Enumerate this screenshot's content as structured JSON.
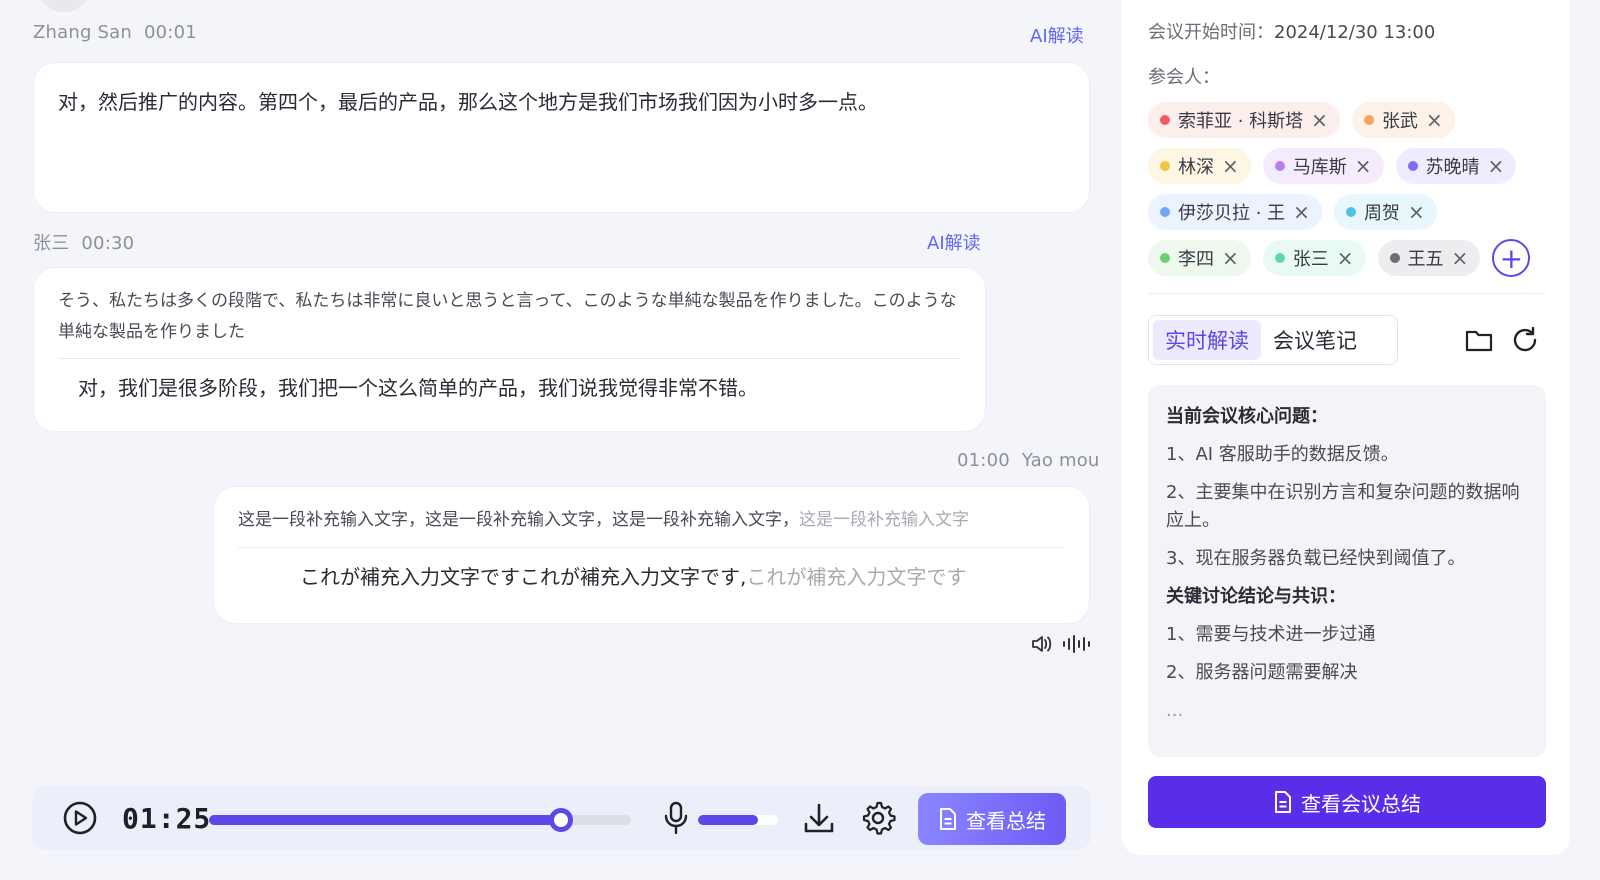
{
  "messages": [
    {
      "speaker": "Zhang San",
      "time": "00:01",
      "ai_label": "AI解读",
      "text": "对，然后推广的内容。第四个，最后的产品，那么这个地方是我们市场我们因为小时多一点。"
    },
    {
      "speaker": "张三",
      "time": "00:30",
      "ai_label": "AI解读",
      "original": "そう、私たちは多くの段階で、私たちは非常に良いと思うと言って、このような単純な製品を作りました。このような単純な製品を作りました",
      "translation": "对，我们是很多阶段，我们把一个这么简单的产品，我们说我觉得非常不错。"
    },
    {
      "speaker": "Yao mou",
      "time": "01:00",
      "original": "这是一段补充输入文字，这是一段补充输入文字，这是一段补充输入文字，",
      "original_pending": "这是一段补充输入文字",
      "translation": "これが補充入力文字ですこれが補充入力文字です,",
      "translation_pending": "これが補充入力文字です"
    }
  ],
  "player": {
    "time": "01:25",
    "progress": 0.835,
    "volume": 0.75,
    "summary_label": "查看总结"
  },
  "panel": {
    "start_time_label": "会议开始时间：",
    "start_time": "2024/12/30 13:00",
    "participants_label": "参会人：",
    "participants": [
      {
        "name": "索菲亚 · 科斯塔",
        "color": "#f25c5c",
        "bg": "#fdeeee"
      },
      {
        "name": "张武",
        "color": "#f6a35c",
        "bg": "#fdf1e8"
      },
      {
        "name": "林深",
        "color": "#f5c542",
        "bg": "#fdf6e3"
      },
      {
        "name": "马库斯",
        "color": "#b87ef0",
        "bg": "#f4ecfd"
      },
      {
        "name": "苏晚晴",
        "color": "#7c6cf0",
        "bg": "#efedfd"
      },
      {
        "name": "伊莎贝拉 · 王",
        "color": "#6ea8f5",
        "bg": "#ebf3fe"
      },
      {
        "name": "周贺",
        "color": "#4fc3e6",
        "bg": "#e8f7fc"
      },
      {
        "name": "李四",
        "color": "#6cd06c",
        "bg": "#edf9ed"
      },
      {
        "name": "张三",
        "color": "#5fd3b5",
        "bg": "#e9f9f4"
      },
      {
        "name": "王五",
        "color": "#6b6d78",
        "bg": "#ededf0"
      }
    ],
    "tabs": [
      "实时解读",
      "会议笔记"
    ],
    "notes": {
      "heading1": "当前会议核心问题：",
      "items1": [
        "1、AI 客服助手的数据反馈。",
        "2、主要集中在识别方言和复杂问题的数据响应上。",
        "3、现在服务器负载已经快到阈值了。"
      ],
      "heading2": "关键讨论结论与共识：",
      "items2": [
        "1、需要与技术进一步过通",
        "2、服务器问题需要解决"
      ],
      "ellipsis": "..."
    },
    "summary_button": "查看会议总结"
  },
  "icons": {
    "play": "play-icon",
    "mic": "mic-icon",
    "download": "download-icon",
    "settings": "gear-icon",
    "document": "document-icon",
    "folder": "folder-icon",
    "refresh": "refresh-icon",
    "speaker": "speaker-icon",
    "waveform": "waveform-icon",
    "add": "plus-icon"
  },
  "colors": {
    "accent": "#5a49e6",
    "primary_button": "#5a2ee8"
  }
}
